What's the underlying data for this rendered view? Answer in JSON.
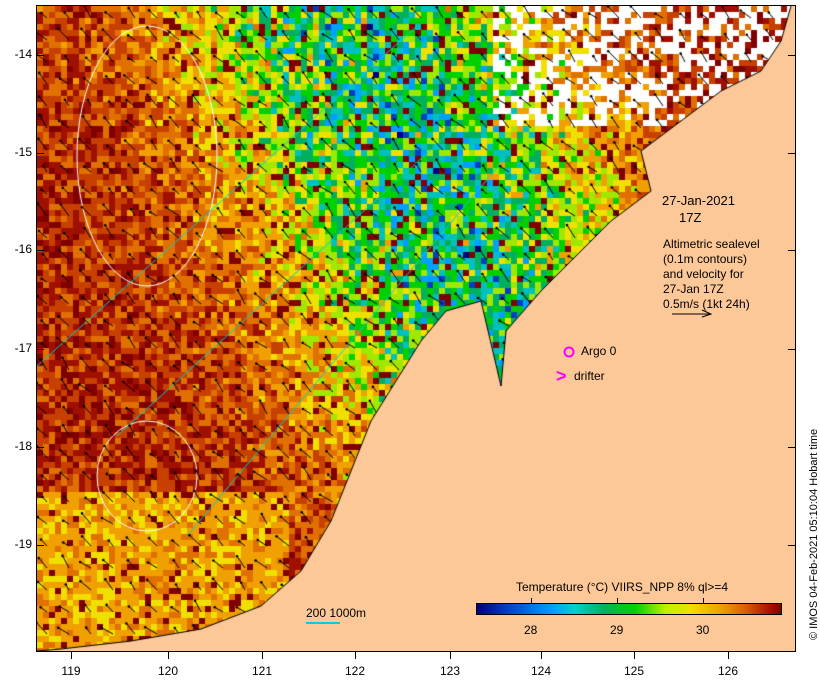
{
  "axes": {
    "lat_labels": [
      "-14",
      "-15",
      "-16",
      "-17",
      "-18",
      "-19"
    ],
    "lon_labels": [
      "119",
      "120",
      "121",
      "122",
      "123",
      "124",
      "125",
      "126"
    ]
  },
  "annotation": {
    "date": "27-Jan-2021",
    "time": "17Z",
    "desc_lines": [
      "Altimetric sealevel",
      "(0.1m contours)",
      "and velocity for",
      "27-Jan 17Z",
      "0.5m/s (1kt 24h)"
    ]
  },
  "markers": {
    "argo_label": "Argo 0",
    "drifter_label": "drifter",
    "argo_color": "#ff00ff"
  },
  "scalebar": {
    "label": "200  1000m",
    "color": "#00d0d0"
  },
  "colorbar": {
    "title": "Temperature (°C) VIIRS_NPP 8% ql>=4",
    "ticks": [
      "28",
      "29",
      "30"
    ],
    "range_c": [
      27.3,
      30.9
    ]
  },
  "credit": "© IMOS 04-Feb-2021 05:10:04 Hobart time",
  "colors": {
    "land": "#fdc898",
    "cloud": "#ffffff",
    "arrows": "#000000",
    "contours": "#ffffff"
  }
}
